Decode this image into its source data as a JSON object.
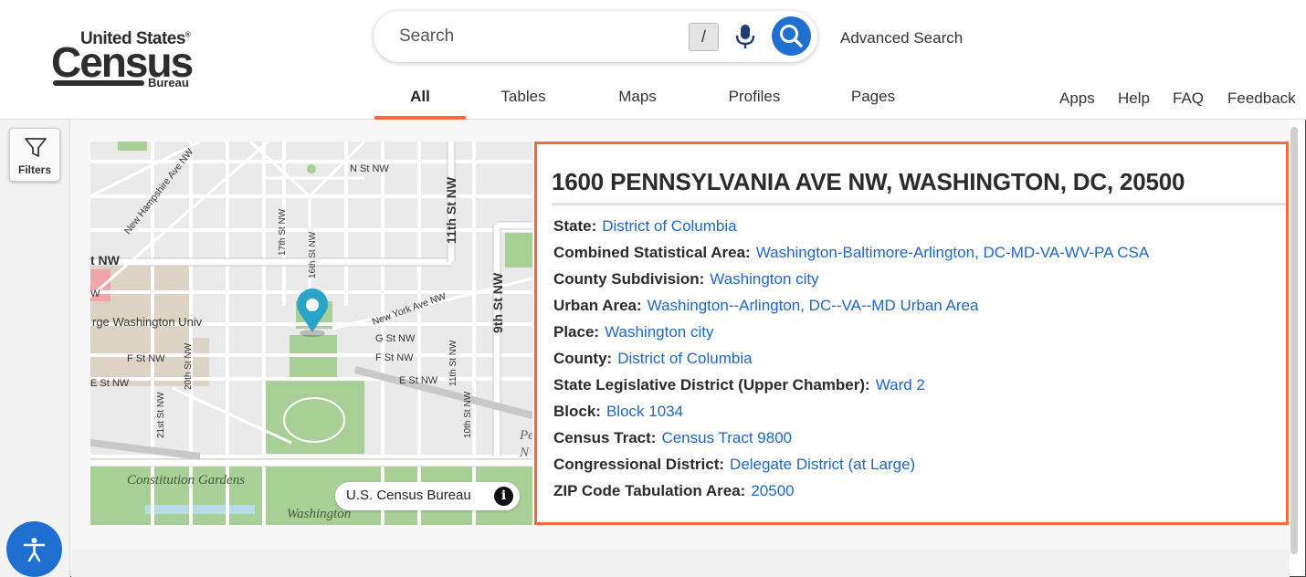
{
  "logo": {
    "top": "United States",
    "main": "Census",
    "bottom": "Bureau"
  },
  "search": {
    "placeholder": "Search",
    "shortcut": "/"
  },
  "advanced_search": "Advanced Search",
  "tabs": [
    {
      "label": "All",
      "active": true
    },
    {
      "label": "Tables"
    },
    {
      "label": "Maps"
    },
    {
      "label": "Profiles"
    },
    {
      "label": "Pages"
    }
  ],
  "utility_links": [
    "Apps",
    "Help",
    "FAQ",
    "Feedback"
  ],
  "filters_label": "Filters",
  "map": {
    "attribution": "U.S. Census Bureau",
    "labels": {
      "n_st": "N St NW",
      "eleventh": "11th St NW",
      "ninth": "9th St NW",
      "nh_ave": "New Hampshire Ave NW",
      "ny_ave": "New York Ave NW",
      "seventeenth": "17th St NW",
      "sixteenth": "16th St NW",
      "gw_univ": "rge Washington Univ",
      "t_nw": "t NW",
      "w": "W",
      "f_st": "F St NW",
      "f_st2": "F St NW",
      "g_st": "G St NW",
      "e_st": "E St NW",
      "e_st_left": "E St NW",
      "twentieth": "20th St NW",
      "twentyfirst": "21st St NW",
      "eleventh_small": "11th St NW",
      "tenth": "10th St NW",
      "constitution": "Constitution Gardens",
      "washington": "Washington",
      "pe": "Pe",
      "n": "N"
    }
  },
  "details": {
    "title": "1600 PENNSYLVANIA AVE NW, WASHINGTON, DC, 20500",
    "rows": [
      {
        "label": "State:",
        "value": "District of Columbia"
      },
      {
        "label": "Combined Statistical Area:",
        "value": "Washington-Baltimore-Arlington, DC-MD-VA-WV-PA CSA"
      },
      {
        "label": "County Subdivision:",
        "value": "Washington city"
      },
      {
        "label": "Urban Area:",
        "value": "Washington--Arlington, DC--VA--MD Urban Area"
      },
      {
        "label": "Place:",
        "value": "Washington city"
      },
      {
        "label": "County:",
        "value": "District of Columbia"
      },
      {
        "label": "State Legislative District (Upper Chamber):",
        "value": "Ward 2"
      },
      {
        "label": "Block:",
        "value": "Block 1034"
      },
      {
        "label": "Census Tract:",
        "value": "Census Tract 9800"
      },
      {
        "label": "Congressional District:",
        "value": "Delegate District (at Large)"
      },
      {
        "label": "ZIP Code Tabulation Area:",
        "value": "20500"
      }
    ]
  },
  "colors": {
    "accent": "#f26c3d",
    "link": "#1f67c2",
    "primary_button": "#1f6fd1",
    "marker": "#2aa3c9"
  }
}
